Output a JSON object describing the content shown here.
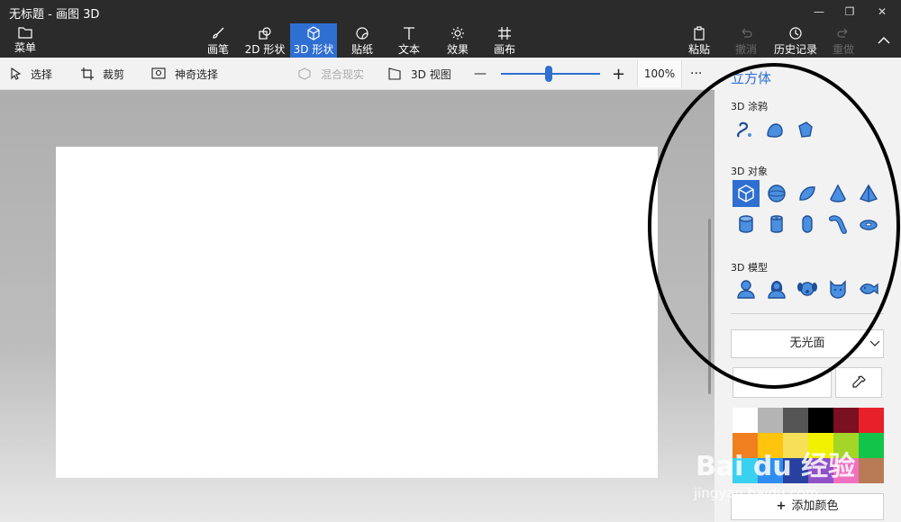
{
  "window": {
    "title": "无标题 - 画图 3D",
    "minimize": "—",
    "restore": "❐",
    "close": "✕"
  },
  "ribbon": {
    "menu": "菜单",
    "tabs": [
      {
        "label": "画笔",
        "icon": "brush-icon"
      },
      {
        "label": "2D 形状",
        "icon": "2d-shapes-icon"
      },
      {
        "label": "3D 形状",
        "icon": "3d-shapes-icon",
        "active": true
      },
      {
        "label": "贴纸",
        "icon": "stickers-icon"
      },
      {
        "label": "文本",
        "icon": "text-icon"
      },
      {
        "label": "效果",
        "icon": "effects-icon"
      },
      {
        "label": "画布",
        "icon": "canvas-icon"
      }
    ],
    "paste": "粘贴",
    "undo": "撤消",
    "history": "历史记录",
    "redo": "重做"
  },
  "toolbar": {
    "select": "选择",
    "crop": "裁剪",
    "magic_select": "神奇选择",
    "mixed_reality": "混合现实",
    "view_3d": "3D 视图",
    "zoom_minus": "—",
    "zoom_plus": "+",
    "zoom_value": "100%",
    "zoom_fraction": 0.48,
    "more": "···"
  },
  "panel": {
    "title": "立方体",
    "doodle_title": "3D 涂鸦",
    "objects_title": "3D 对象",
    "models_title": "3D 模型",
    "finish": "无光面",
    "add_color": "添加颜色",
    "palette": [
      "#ffffff",
      "#b4b4b4",
      "#555555",
      "#000000",
      "#7a1020",
      "#e8202a",
      "#f07f20",
      "#ffc40c",
      "#f6e05a",
      "#f0f000",
      "#a4d628",
      "#13c44a",
      "#3ad0f0",
      "#2e8ef0",
      "#2840a0",
      "#9050c8",
      "#f070c0",
      "#b97a56"
    ]
  },
  "watermark": {
    "brand": "Bai du 经验",
    "url": "jingyan.baidu.com"
  }
}
